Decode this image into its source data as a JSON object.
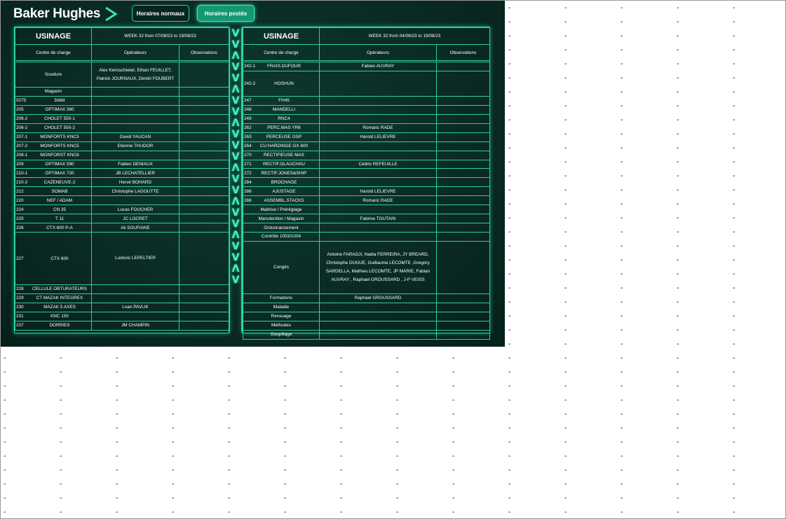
{
  "app": {
    "brand": "Baker Hughes",
    "tabs": {
      "normal": "Horaires normaux",
      "poste": "Horaires postés"
    }
  },
  "left_panel": {
    "title": "USINAGE",
    "week": "WEEK 32 from 07/08/23 to 19/08/23",
    "headers": {
      "center": "Centre de charge",
      "ops": "Opérateurs",
      "obs": "Observations"
    },
    "rows": [
      {
        "code": "",
        "name": "Soudure",
        "ops": "Alex Keirsschieter, Ethan FEUILLET, Patrick JOURNAUX, Dimitri FOUBERT"
      },
      {
        "code": "",
        "name": "Magasin",
        "ops": ""
      },
      {
        "code": "0275",
        "name": "Débit",
        "ops": ""
      },
      {
        "code": "205",
        "name": "OPTIMAX 360",
        "ops": ""
      },
      {
        "code": "206-2",
        "name": "CHOLET 550-1",
        "ops": ""
      },
      {
        "code": "206-2",
        "name": "CHOLET 550-2",
        "ops": ""
      },
      {
        "code": "207-1",
        "name": "MONFORTS KNC5",
        "ops": "David YAUCAN"
      },
      {
        "code": "207-2",
        "name": "MONFORTS KNC5",
        "ops": "Etienne THUDOR"
      },
      {
        "code": "208-1",
        "name": "MONFORST KNC6",
        "ops": ""
      },
      {
        "code": "209",
        "name": "OPTIMAX 590",
        "ops": "Fabien DENIAUX"
      },
      {
        "code": "210-1",
        "name": "OPTIMAX 720",
        "ops": "JB LECHATELLIER"
      },
      {
        "code": "210-2",
        "name": "CAZENEUVE-2",
        "ops": "Hervé BOHARD"
      },
      {
        "code": "212",
        "name": "SOMAB",
        "ops": "Christophe LAGOUTTE"
      },
      {
        "code": "220",
        "name": "NEF / ADAM",
        "ops": ""
      },
      {
        "code": "224",
        "name": "CN 35",
        "ops": "Lucas FOUCHER"
      },
      {
        "code": "225",
        "name": "T 11",
        "ops": "JC LOCRET"
      },
      {
        "code": "226",
        "name": "CTX 600 P-A",
        "ops": "Ali SOUFIANE"
      },
      {
        "code": "227",
        "name": "CTX 600",
        "ops": "Ludovic LEPELTIER"
      },
      {
        "code": "228",
        "name": "CELLULE OBTURATEURS",
        "ops": ""
      },
      {
        "code": "229",
        "name": "CT MAZAK INTEGREX",
        "ops": ""
      },
      {
        "code": "230",
        "name": "MAZAK 5 AXES",
        "ops": "Loan PAVLIK"
      },
      {
        "code": "231",
        "name": "KNC 150",
        "ops": ""
      },
      {
        "code": "237",
        "name": "DORRIES",
        "ops": "JM CHAMPIN"
      }
    ]
  },
  "right_panel": {
    "title": "USINAGE",
    "week": "WEEK 32 from 04/08/23 to 19/08/23",
    "headers": {
      "center": "Centre de charge",
      "ops": "Opérateurs",
      "obs": "Observations"
    },
    "rows": [
      {
        "code": "242-1",
        "name": "FRAIS.DUFOUR",
        "ops": "Fabian AUVRAY"
      },
      {
        "code": "242-2",
        "name": "HOSHUN",
        "ops": ""
      },
      {
        "code": "247",
        "name": "FH45",
        "ops": ""
      },
      {
        "code": "248",
        "name": "MANDELLI",
        "ops": ""
      },
      {
        "code": "249",
        "name": "RNC4",
        "ops": ""
      },
      {
        "code": "262",
        "name": "PERC.MAS YR6",
        "ops": "Romaric RADE"
      },
      {
        "code": "263",
        "name": "PERCEUSE GSP",
        "ops": "Harold LELIEVRE"
      },
      {
        "code": "264",
        "name": "CU HARDINGE GX 600",
        "ops": ""
      },
      {
        "code": "270",
        "name": "RECTIFIEUSE MAS",
        "ops": ""
      },
      {
        "code": "271",
        "name": "RECTIF.GLAUCHAU",
        "ops": "Cédric REFEUILLE"
      },
      {
        "code": "272",
        "name": "RECTIF.JONES&SHIP",
        "ops": ""
      },
      {
        "code": "284",
        "name": "BROCHAGE",
        "ops": ""
      },
      {
        "code": "286",
        "name": "AJUSTAGE",
        "ops": "Harold LELIEVRE"
      },
      {
        "code": "288",
        "name": "ASSEMBL.STACKS",
        "ops": "Romaric RADE"
      },
      {
        "code": "",
        "name": "Maitrise / Préréglage",
        "ops": ""
      },
      {
        "code": "",
        "name": "Manutention / Magasin",
        "ops": "Fabrice TOUTAIN"
      },
      {
        "code": "",
        "name": "Ordonnancement",
        "ops": ""
      },
      {
        "code": "",
        "name": "Contrôle 1003/1004",
        "ops": ""
      },
      {
        "code": "",
        "name": "Congés",
        "ops": "Antoine FARADJI, Nadia FERREIRA, JY BREARD, Christophe DUGUE, Guillaume LECOMTE ,Gregory SARDELLA, Mathieu LECOMTE, JP MARIE, Fabian AUVRAY , Raphael GROUSSARD , J-P VEISS"
      },
      {
        "code": "",
        "name": "Formations",
        "ops": "Raphael GROUSSARD"
      },
      {
        "code": "",
        "name": "Maladie",
        "ops": ""
      },
      {
        "code": "",
        "name": "Ressuage",
        "ops": ""
      },
      {
        "code": "",
        "name": "Méthodes",
        "ops": ""
      },
      {
        "code": "",
        "name": "Goupillage",
        "ops": ""
      }
    ]
  },
  "divider": {
    "symbols": [
      "V",
      "V",
      "Λ",
      "V",
      "V",
      "Λ",
      "V",
      "V",
      "Λ",
      "V",
      "V",
      "V",
      "Λ",
      "V",
      "V",
      "Λ",
      "V",
      "V",
      "Λ",
      "V",
      "V",
      "Λ",
      "V"
    ]
  },
  "grid_filler": "-",
  "colors": {
    "accent": "#2fd9a9",
    "background": "#0a2c25",
    "active_tab": "#139873"
  }
}
